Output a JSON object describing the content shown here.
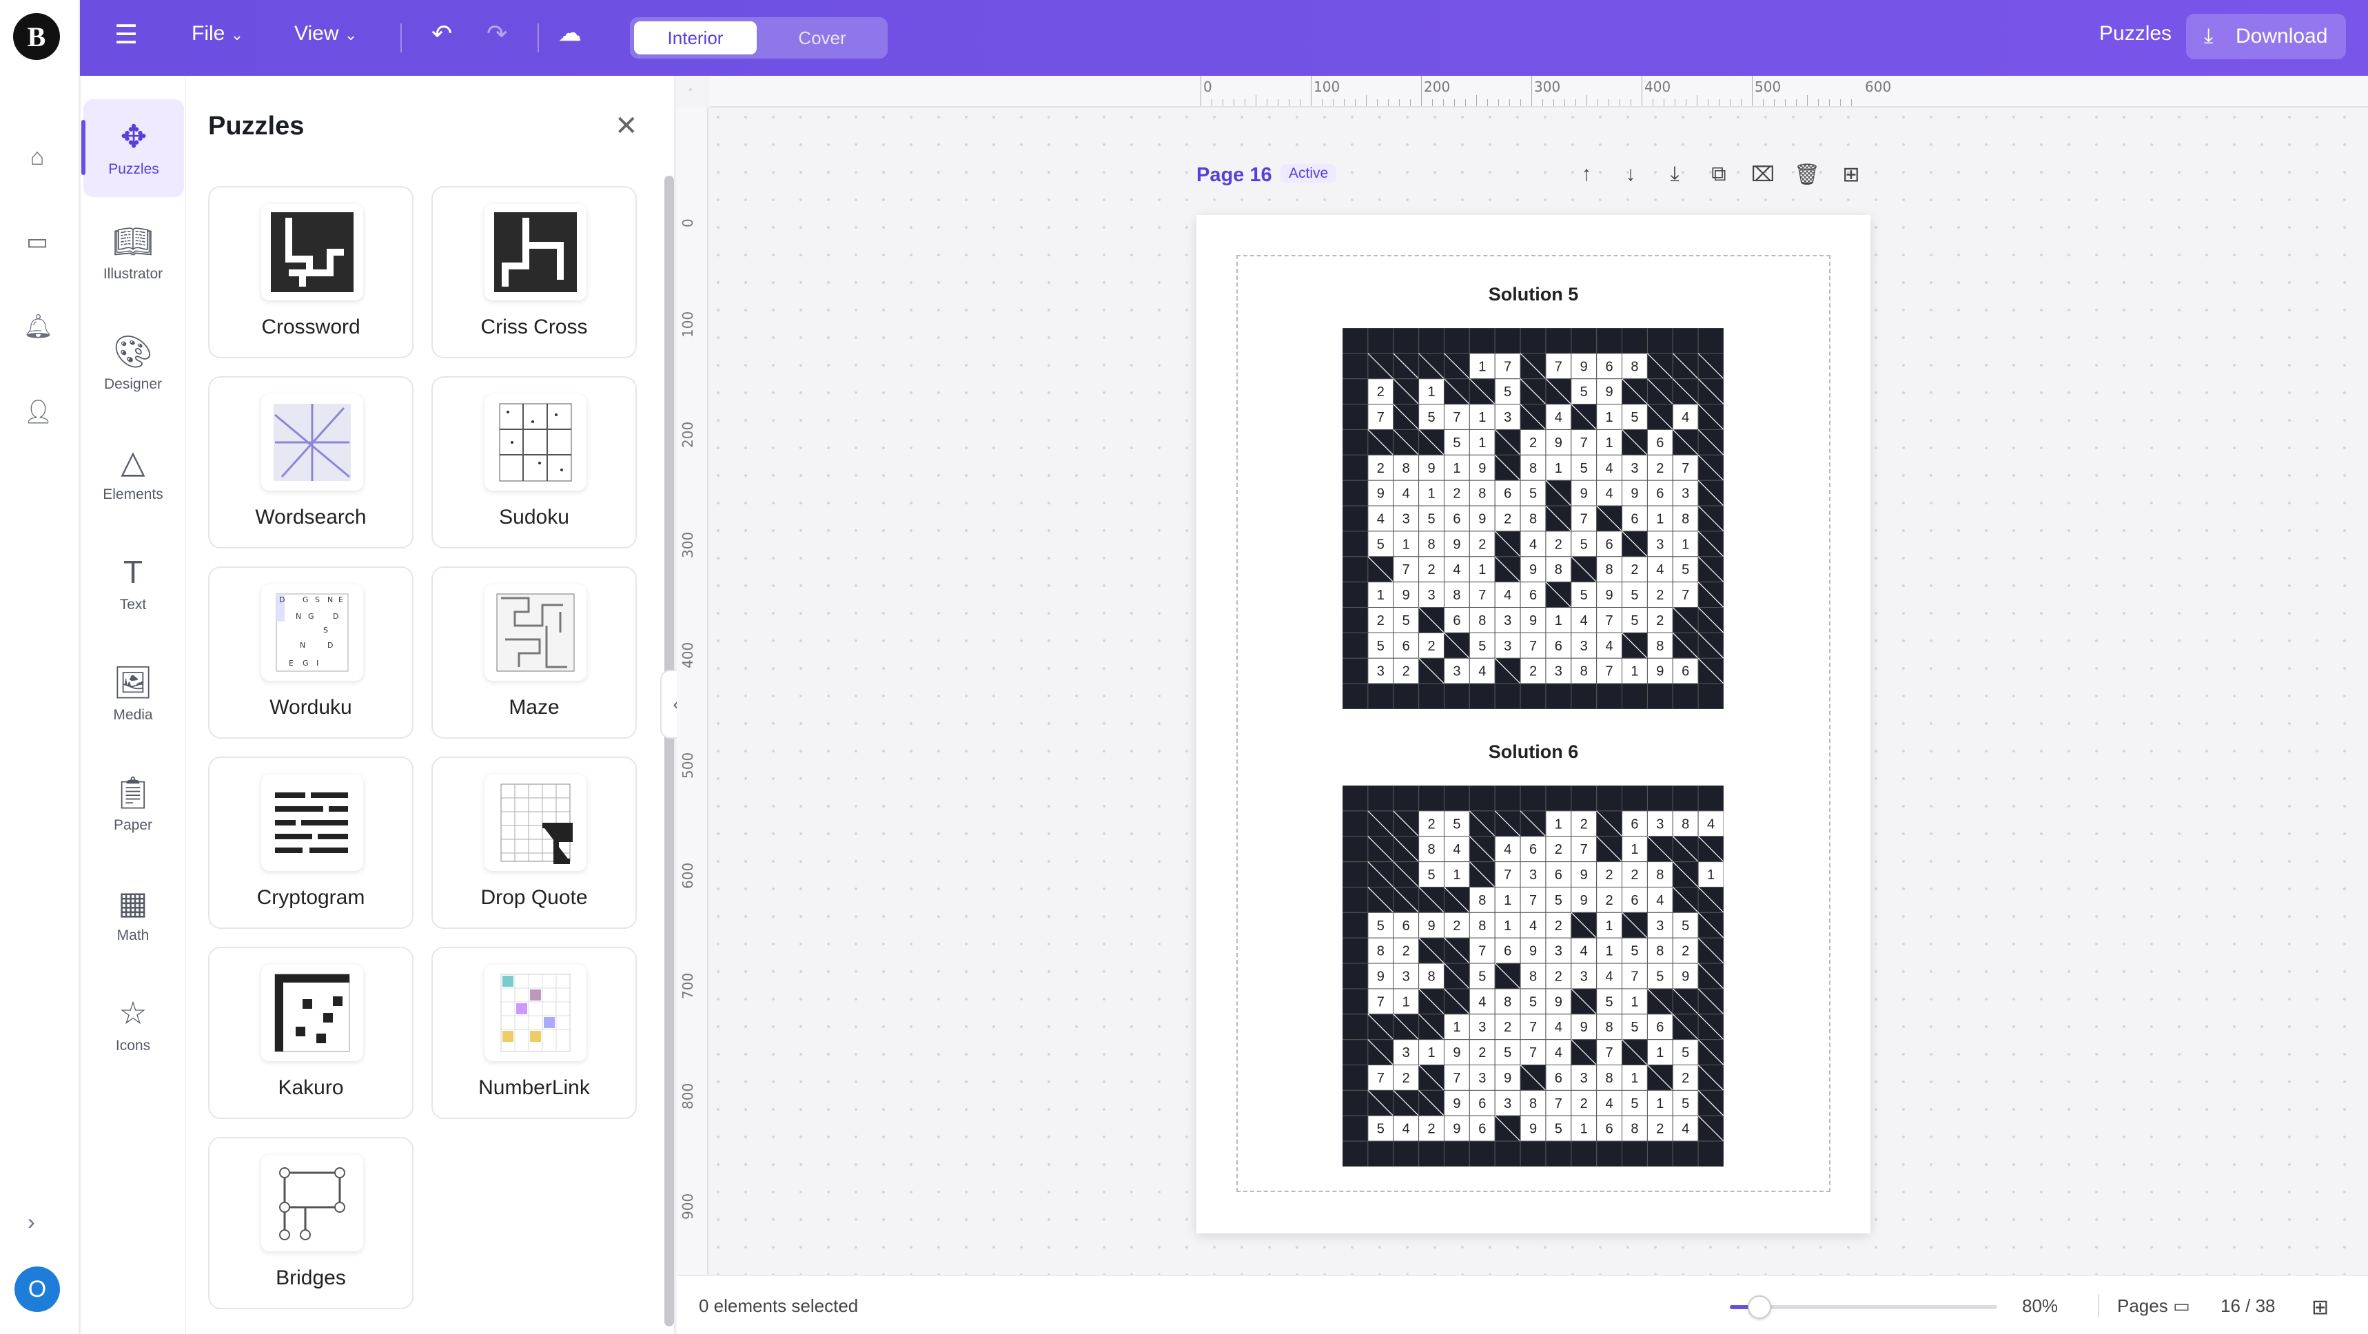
{
  "app": {
    "logo_letter": "B"
  },
  "topbar": {
    "file_label": "File",
    "view_label": "View",
    "mode_tabs": [
      "Interior",
      "Cover"
    ],
    "active_mode": "Interior",
    "puzzles_label": "Puzzles",
    "download_label": "Download"
  },
  "rail": {
    "avatar_letter": "O",
    "icons": [
      "home-icon",
      "folder-icon",
      "bell-icon",
      "user-icon"
    ]
  },
  "nav": {
    "items": [
      {
        "label": "Puzzles",
        "icon": "puzzle-icon"
      },
      {
        "label": "Illustrator",
        "icon": "book-icon"
      },
      {
        "label": "Designer",
        "icon": "palette-icon"
      },
      {
        "label": "Elements",
        "icon": "shapes-icon"
      },
      {
        "label": "Text",
        "icon": "text-icon"
      },
      {
        "label": "Media",
        "icon": "image-icon"
      },
      {
        "label": "Paper",
        "icon": "paper-icon"
      },
      {
        "label": "Math",
        "icon": "calculator-icon"
      },
      {
        "label": "Icons",
        "icon": "star-icon"
      }
    ],
    "active": "Puzzles"
  },
  "panel": {
    "title": "Puzzles",
    "cards": [
      "Crossword",
      "Criss Cross",
      "Wordsearch",
      "Sudoku",
      "Worduku",
      "Maze",
      "Cryptogram",
      "Drop Quote",
      "Kakuro",
      "NumberLink",
      "Bridges"
    ]
  },
  "rulers": {
    "top": [
      "0",
      "100",
      "200",
      "300",
      "400",
      "500",
      "600"
    ],
    "left": [
      "0",
      "100",
      "200",
      "300",
      "400",
      "500",
      "600",
      "700",
      "800",
      "900"
    ]
  },
  "page": {
    "title": "Page 16",
    "badge": "Active",
    "solutions": [
      {
        "title": "Solution 5",
        "rows": [
          "############## ",
          "#####17#7968##",
          "#2#1##5##59###",
          "#7#5713#4#15#4",
          "####51#2971#6",
          "#28919#8154327",
          "#9412865#94963",
          "#4356928#7#618",
          "#51892#4256#31",
          "##7241#98#8245",
          "#1938746#59527",
          "#25#683914752",
          "#562#537634#8",
          "#32#34#2387196",
          "##############"
        ]
      },
      {
        "title": "Solution 6",
        "rows": [
          "##############",
          "###25###12#6384",
          "###84#4627#1##",
          "###51#7369228#1",
          "#####81759264",
          "#56928142#1#35",
          "#82##769341582",
          "#938#5#8234759",
          "#71##4859#51##",
          "####132749856",
          "##3192574#7#15",
          "#72#739#6381#2",
          "####9638724515",
          "#54296#9516824",
          "##############"
        ]
      }
    ]
  },
  "status": {
    "selection": "0 elements selected",
    "zoom": "80%",
    "zoom_fraction": 0.11,
    "pages_label": "Pages",
    "page_count": "16 / 38"
  }
}
